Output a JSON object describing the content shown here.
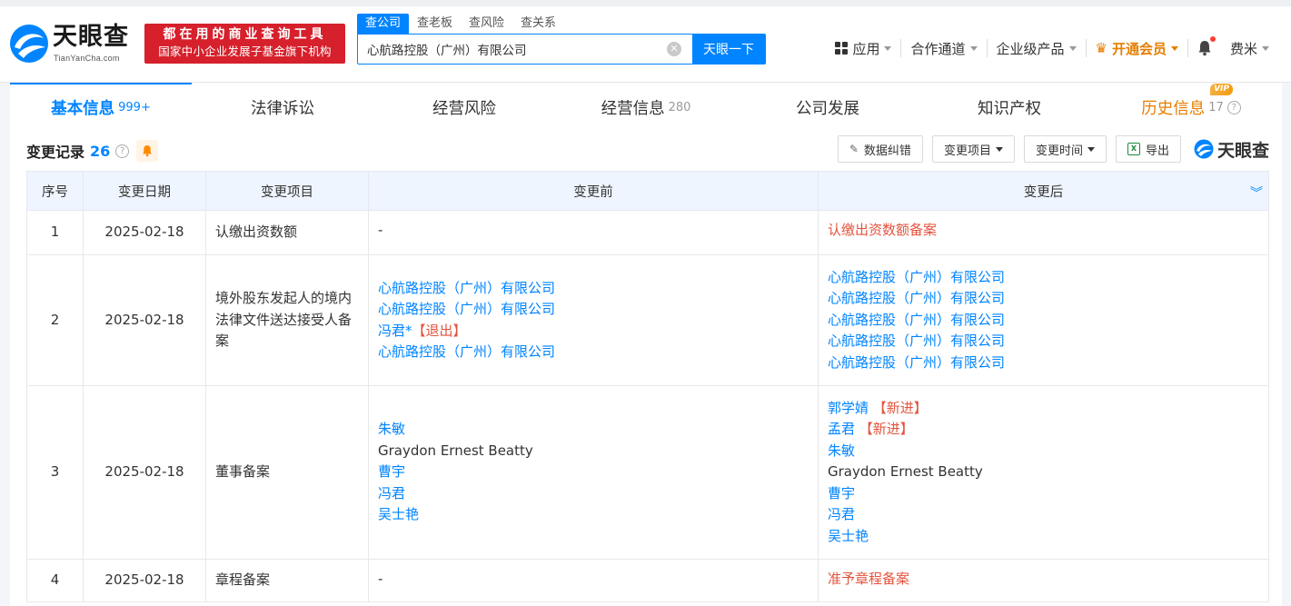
{
  "header": {
    "logo_text": "天眼查",
    "logo_sub": "TianYanCha.com",
    "slogan_line1": "都在用的商业查询工具",
    "slogan_line2": "国家中小企业发展子基金旗下机构",
    "search_tabs": [
      "查公司",
      "查老板",
      "查风险",
      "查关系"
    ],
    "search_value": "心航路控股（广州）有限公司",
    "search_button": "天眼一下",
    "nav": {
      "apps": "应用",
      "channel": "合作通道",
      "enterprise": "企业级产品",
      "vip": "开通会员",
      "user": "费米"
    }
  },
  "tabs": [
    {
      "label": "基本信息",
      "count": "999+"
    },
    {
      "label": "法律诉讼",
      "count": ""
    },
    {
      "label": "经营风险",
      "count": ""
    },
    {
      "label": "经营信息",
      "count": "280"
    },
    {
      "label": "公司发展",
      "count": ""
    },
    {
      "label": "知识产权",
      "count": ""
    },
    {
      "label": "历史信息",
      "count": "17"
    }
  ],
  "vip_badge": "VIP",
  "section": {
    "title": "变更记录",
    "count": "26",
    "tools": {
      "correct": "数据纠错",
      "item_filter": "变更项目",
      "time_filter": "变更时间",
      "export": "导出",
      "brand": "天眼查"
    }
  },
  "table": {
    "headers": [
      "序号",
      "变更日期",
      "变更项目",
      "变更前",
      "变更后"
    ],
    "rows": [
      {
        "no": "1",
        "date": "2025-02-18",
        "item": "认缴出资数额",
        "before": [
          {
            "text": "-",
            "color": "plain"
          }
        ],
        "after": [
          {
            "text": "认缴出资数额备案",
            "color": "red"
          }
        ]
      },
      {
        "no": "2",
        "date": "2025-02-18",
        "item": "境外股东发起人的境内法律文件送达接受人备案",
        "before": [
          {
            "text": "心航路控股（广州）有限公司",
            "color": "blue"
          },
          {
            "text": "心航路控股（广州）有限公司",
            "color": "blue"
          },
          {
            "text": "冯君*",
            "color": "blue",
            "tag": "【退出】"
          },
          {
            "text": "心航路控股（广州）有限公司",
            "color": "blue"
          }
        ],
        "after": [
          {
            "text": "心航路控股（广州）有限公司",
            "color": "blue"
          },
          {
            "text": "心航路控股（广州）有限公司",
            "color": "blue"
          },
          {
            "text": "心航路控股（广州）有限公司",
            "color": "blue"
          },
          {
            "text": "心航路控股（广州）有限公司",
            "color": "blue"
          },
          {
            "text": "心航路控股（广州）有限公司",
            "color": "blue"
          }
        ]
      },
      {
        "no": "3",
        "date": "2025-02-18",
        "item": "董事备案",
        "before": [
          {
            "text": "朱敏",
            "color": "blue"
          },
          {
            "text": "Graydon Ernest Beatty",
            "color": "plain"
          },
          {
            "text": "曹宇",
            "color": "blue"
          },
          {
            "text": "冯君",
            "color": "blue"
          },
          {
            "text": "吴士艳",
            "color": "blue"
          }
        ],
        "after": [
          {
            "text": "郭学婧 ",
            "color": "blue",
            "tag": "【新进】"
          },
          {
            "text": "孟君 ",
            "color": "blue",
            "tag": "【新进】"
          },
          {
            "text": "朱敏",
            "color": "blue"
          },
          {
            "text": "Graydon Ernest Beatty",
            "color": "plain"
          },
          {
            "text": "曹宇",
            "color": "blue"
          },
          {
            "text": "冯君",
            "color": "blue"
          },
          {
            "text": "吴士艳",
            "color": "blue"
          }
        ]
      },
      {
        "no": "4",
        "date": "2025-02-18",
        "item": "章程备案",
        "before": [
          {
            "text": "-",
            "color": "plain"
          }
        ],
        "after": [
          {
            "text": "准予章程备案",
            "color": "red"
          }
        ]
      }
    ]
  },
  "colors": {
    "accent": "#0084ff",
    "red": "#e5533d",
    "vip": "#e67e00",
    "slogan_bg": "#d6202c"
  }
}
